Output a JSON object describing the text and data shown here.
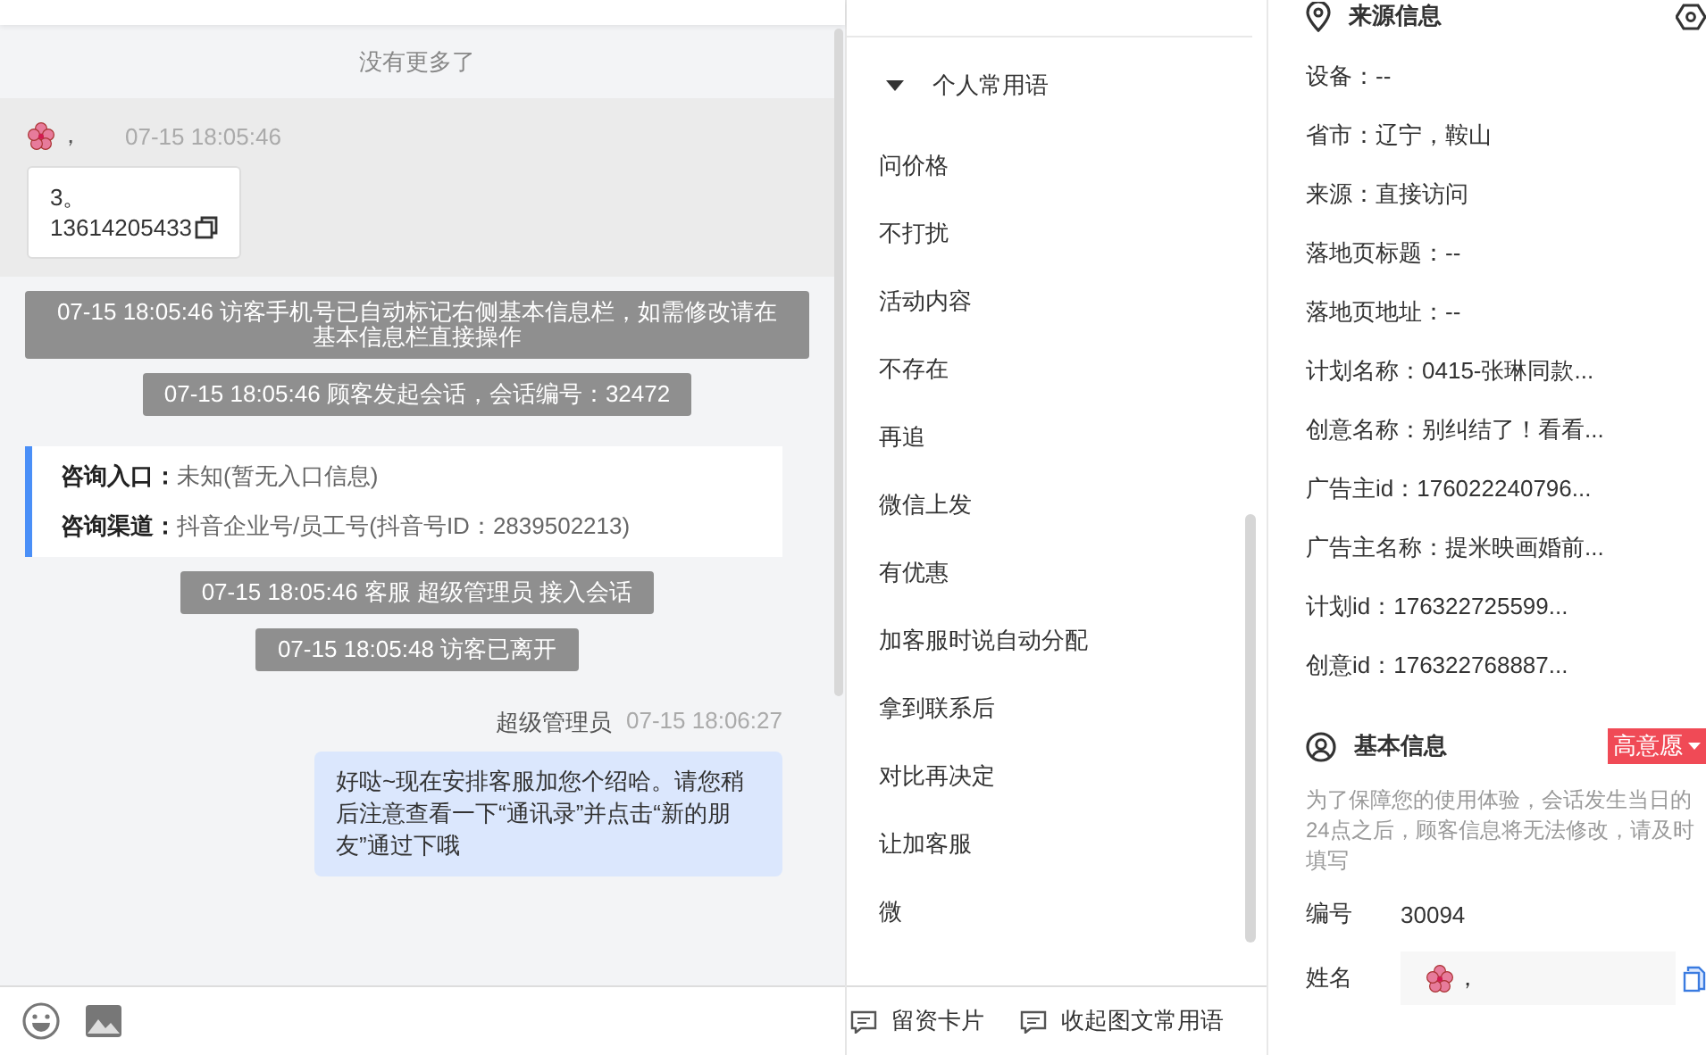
{
  "chat": {
    "no_more": "没有更多了",
    "visitor_message": {
      "sender": "，",
      "time": "07-15 18:05:46",
      "lines": [
        "3。",
        "13614205433"
      ]
    },
    "notices": [
      {
        "kind": "system",
        "text": "07-15 18:05:46 访客手机号已自动标记右侧基本信息栏，如需修改请在基本信息栏直接操作"
      },
      {
        "kind": "system",
        "text": "07-15 18:05:46 顾客发起会话，会话编号：32472"
      },
      {
        "kind": "entry",
        "rows": [
          {
            "label": "咨询入口：",
            "value": "未知(暂无入口信息)"
          },
          {
            "label": "咨询渠道：",
            "value": "抖音企业号/员工号(抖音号ID：2839502213)"
          }
        ]
      },
      {
        "kind": "system",
        "text": "07-15 18:05:46 客服 超级管理员 接入会话"
      },
      {
        "kind": "system",
        "text": "07-15 18:05:48 访客已离开"
      },
      {
        "kind": "agent",
        "sender": "超级管理员",
        "time": "07-15 18:06:27",
        "text": "好哒~现在安排客服加您个绍哈。请您稍后注意查看一下“通讯录”并点击“新的朋友”通过下哦"
      }
    ]
  },
  "phrases": {
    "group": {
      "title": "个人常用语",
      "expanded": true
    },
    "items": [
      "问价格",
      "不打扰",
      "活动内容",
      "不存在",
      "再追",
      "微信上发",
      "有优惠",
      "加客服时说自动分配",
      "拿到联系后",
      "对比再决定",
      "让加客服",
      "微"
    ],
    "buttons": [
      "留资卡片",
      "收起图文常用语"
    ]
  },
  "source_info": {
    "title": "来源信息",
    "fields": [
      "设备：--",
      "省市：辽宁，鞍山",
      "来源：直接访问",
      "落地页标题：--",
      "落地页地址：--",
      "计划名称：0415-张琳同款...",
      "创意名称：别纠结了！看看...",
      "广告主id：176022240796...",
      "广告主名称：提米映画婚前...",
      "计划id：176322725599...",
      "创意id：176322768887..."
    ]
  },
  "basic_info": {
    "title": "基本信息",
    "intent": "高意愿",
    "notice": "为了保障您的使用体验，会话发生当日的24点之后，顾客信息将无法修改，请及时填写",
    "fields": [
      {
        "kind": "text",
        "label": "编号",
        "value": "30094"
      },
      {
        "kind": "input",
        "label": "姓名",
        "value": "，"
      }
    ]
  }
}
